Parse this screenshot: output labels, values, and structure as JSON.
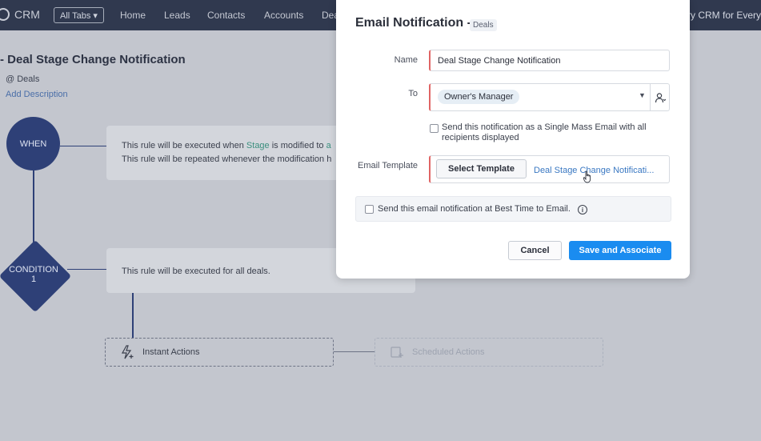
{
  "topnav": {
    "brand": "CRM",
    "all_tabs": "All Tabs ▾",
    "items": [
      "Home",
      "Leads",
      "Contacts",
      "Accounts",
      "Dea"
    ],
    "try_crm": "Try CRM for Every"
  },
  "rule": {
    "title": "- Deal Stage Change Notification",
    "module": "@ Deals",
    "add_description": "Add Description"
  },
  "when": {
    "label": "WHEN",
    "line1_prefix": "This rule will be executed when ",
    "line1_field": "Stage",
    "line1_suffix": " is modified to ",
    "line1_tail": "a",
    "line2": "This rule will be repeated whenever the modification h"
  },
  "condition": {
    "label_line1": "CONDITION",
    "label_line2": "1",
    "text": "This rule will be executed for all deals."
  },
  "actions": {
    "instant": "Instant Actions",
    "scheduled": "Scheduled Actions"
  },
  "modal": {
    "title": "Email Notification -",
    "module_chip": "Deals",
    "name_label": "Name",
    "name_value": "Deal Stage Change Notification",
    "to_label": "To",
    "to_value": "Owner's Manager",
    "mass_email_line1": "Send this notification as a Single Mass Email with all",
    "mass_email_line2": "recipients displayed",
    "template_label": "Email Template",
    "select_template": "Select Template",
    "template_link": "Deal Stage Change Notificati...",
    "best_time": "Send this email notification at Best Time to Email.",
    "cancel": "Cancel",
    "save": "Save and Associate"
  },
  "colors": {
    "nav_bg": "#30394f",
    "flow_accent": "#2e4077",
    "primary_button": "#1a8cf0",
    "required_marker": "#e06464",
    "link": "#3a78c2"
  }
}
